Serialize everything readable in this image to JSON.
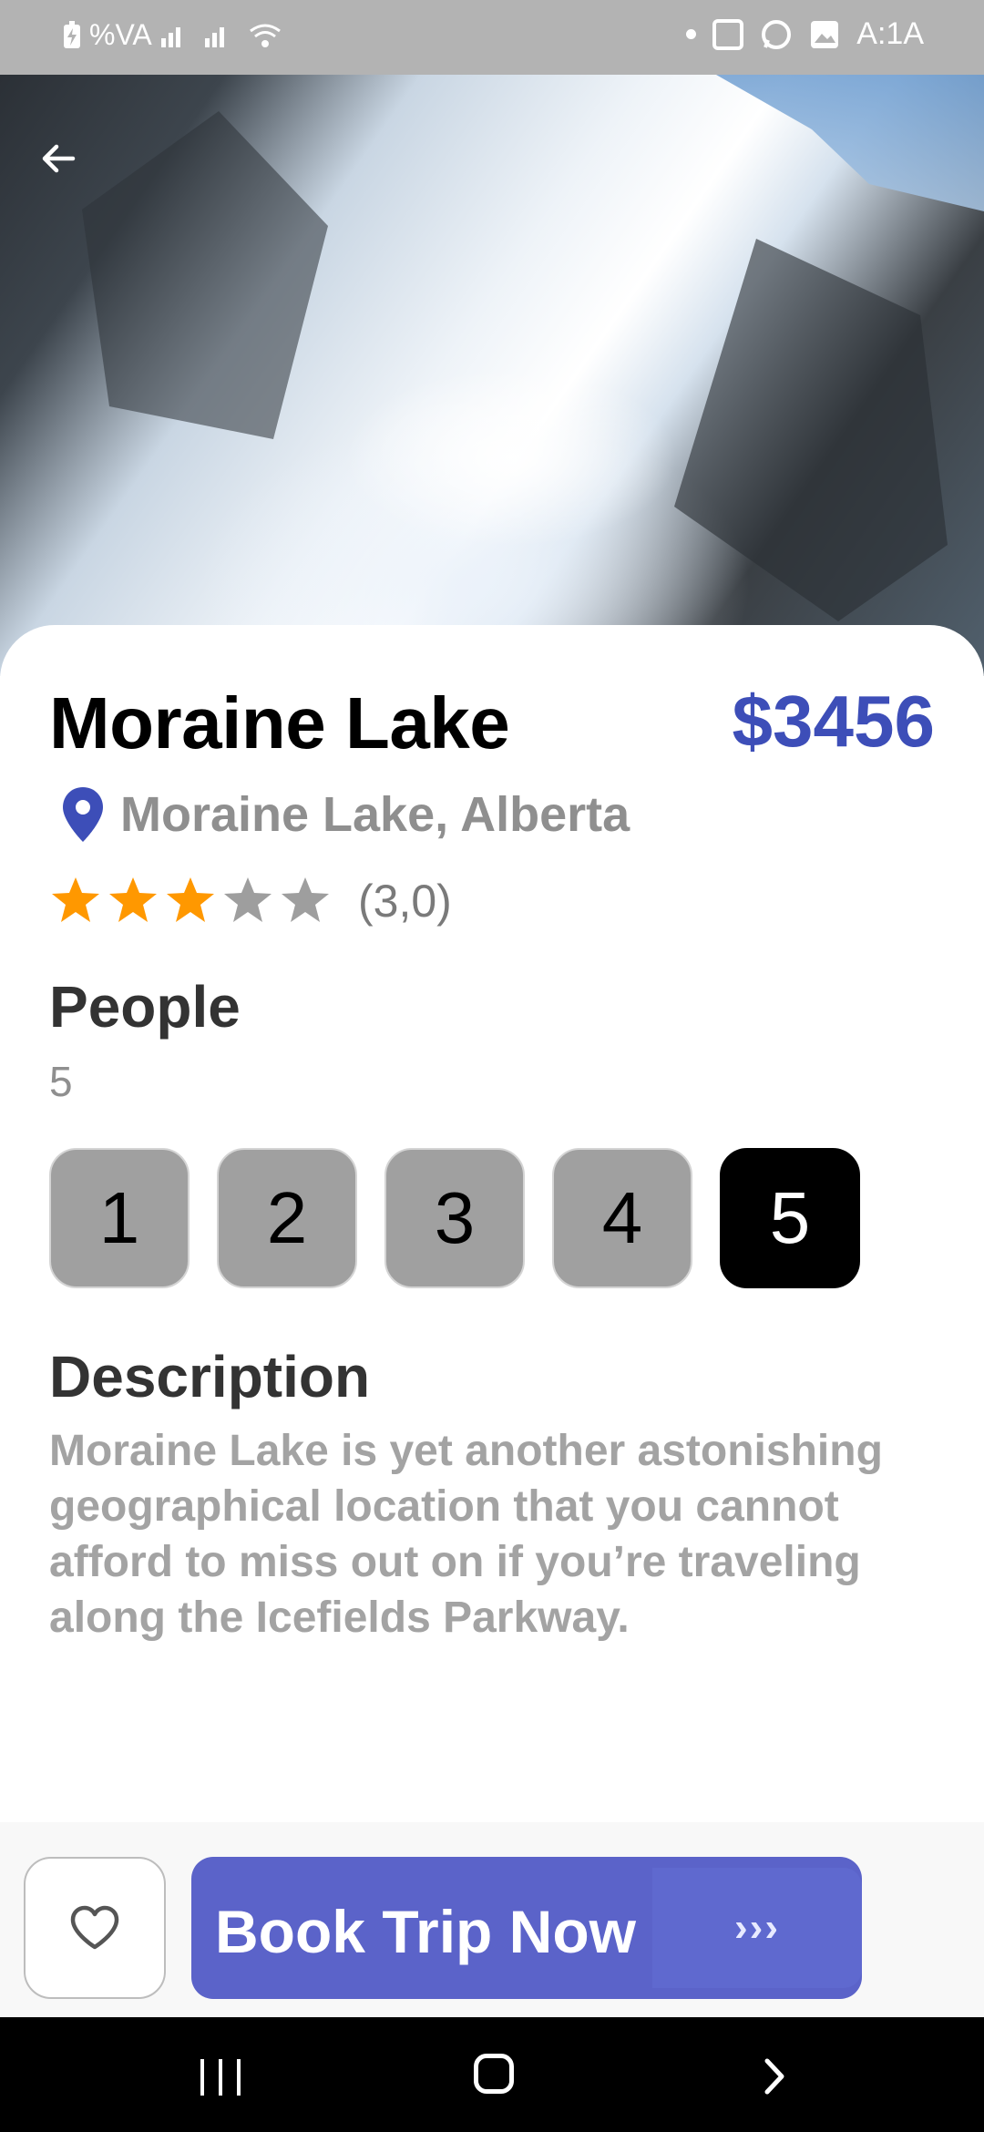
{
  "status_bar": {
    "battery_text": "%VA",
    "time": "A:1A"
  },
  "place": {
    "title": "Moraine Lake",
    "price": "$3456",
    "location": "Moraine Lake, Alberta",
    "rating_value": 3,
    "rating_max": 5,
    "rating_text": "(3,0)"
  },
  "people": {
    "heading": "People",
    "selected_value": "5",
    "options": [
      "1",
      "2",
      "3",
      "4",
      "5"
    ]
  },
  "description": {
    "heading": "Description",
    "text": "Moraine Lake is yet another astonishing geographical location that you cannot afford to miss out on if you’re traveling along the Icefields Parkway."
  },
  "actions": {
    "book_label": "Book Trip Now",
    "book_arrows": "›››"
  },
  "colors": {
    "accent": "#3d4eb8",
    "button": "#5b63c9",
    "star_filled": "#ff9800",
    "star_empty": "#9e9e9e",
    "selected_option": "#000000"
  },
  "icons": {
    "back": "arrow-left-icon",
    "location": "map-pin-icon",
    "favorite": "heart-outline-icon"
  }
}
